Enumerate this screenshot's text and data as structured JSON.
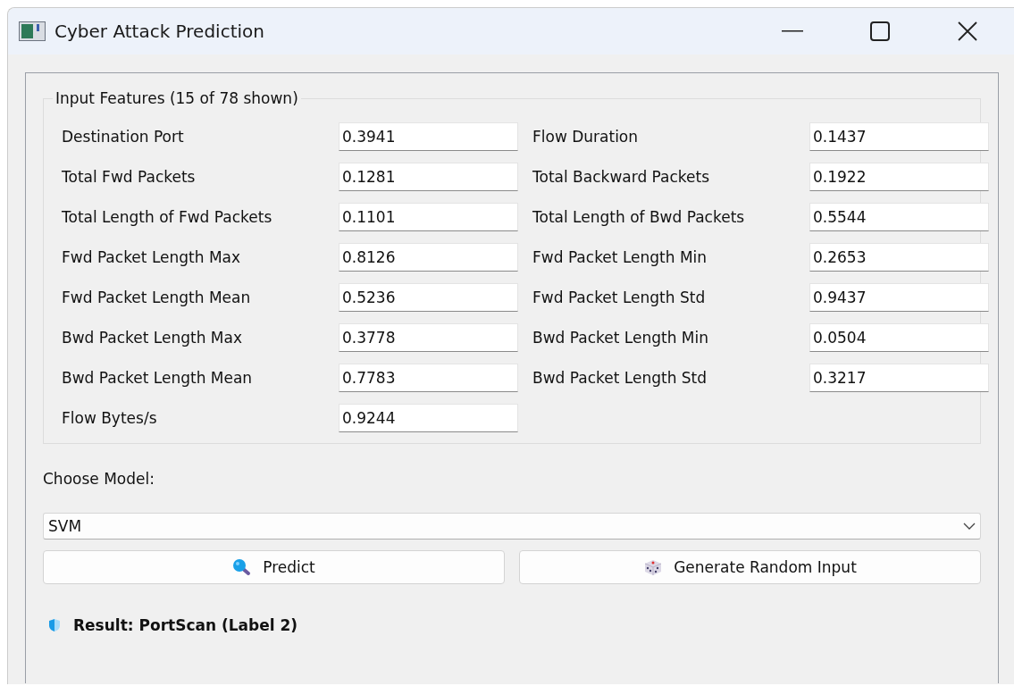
{
  "window": {
    "title": "Cyber Attack Prediction"
  },
  "input_features": {
    "title": "Input Features (15 of 78 shown)",
    "features": [
      {
        "label": "Destination Port",
        "value": "0.3941"
      },
      {
        "label": "Flow Duration",
        "value": "0.1437"
      },
      {
        "label": "Total Fwd Packets",
        "value": "0.1281"
      },
      {
        "label": "Total Backward Packets",
        "value": "0.1922"
      },
      {
        "label": "Total Length of Fwd Packets",
        "value": "0.1101"
      },
      {
        "label": "Total Length of Bwd Packets",
        "value": "0.5544"
      },
      {
        "label": "Fwd Packet Length Max",
        "value": "0.8126"
      },
      {
        "label": "Fwd Packet Length Min",
        "value": "0.2653"
      },
      {
        "label": "Fwd Packet Length Mean",
        "value": "0.5236"
      },
      {
        "label": "Fwd Packet Length Std",
        "value": "0.9437"
      },
      {
        "label": "Bwd Packet Length Max",
        "value": "0.3778"
      },
      {
        "label": "Bwd Packet Length Min",
        "value": "0.0504"
      },
      {
        "label": "Bwd Packet Length Mean",
        "value": "0.7783"
      },
      {
        "label": "Bwd Packet Length Std",
        "value": "0.3217"
      },
      {
        "label": "Flow Bytes/s",
        "value": "0.9244"
      }
    ]
  },
  "model": {
    "label": "Choose Model:",
    "value": "SVM"
  },
  "buttons": [
    {
      "label": "Predict",
      "kind": "search"
    },
    {
      "label": "Generate Random Input",
      "kind": "dice"
    }
  ],
  "result": "Result: PortScan (Label 2)"
}
